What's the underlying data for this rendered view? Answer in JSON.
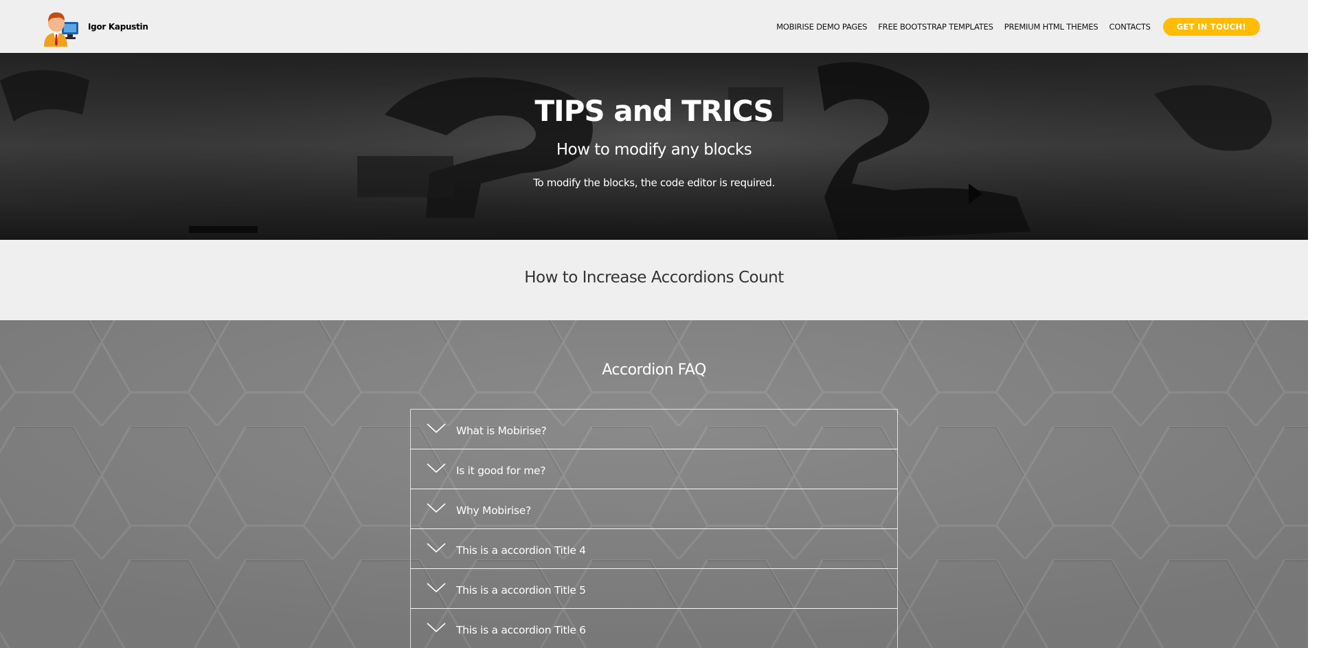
{
  "navbar": {
    "brand_name": "Igor Kapustin",
    "links": [
      "MOBIRISE DEMO PAGES",
      "FREE BOOTSTRAP TEMPLATES",
      "PREMIUM HTML THEMES",
      "CONTACTS"
    ],
    "cta_label": "GET IN TOUCH!",
    "cta_color": "#ffbc00"
  },
  "hero": {
    "title": "TIPS and TRICS",
    "subtitle": "How to modify any blocks",
    "text": "To modify the blocks, the code editor is required."
  },
  "section_increase": {
    "title": "How to Increase Accordions Count"
  },
  "faq": {
    "title": "Accordion FAQ",
    "items": [
      "What is Mobirise?",
      "Is it good for me?",
      "Why Mobirise?",
      "This is a accordion Title 4",
      "This is a accordion Title 5",
      "This is a accordion Title 6"
    ]
  }
}
